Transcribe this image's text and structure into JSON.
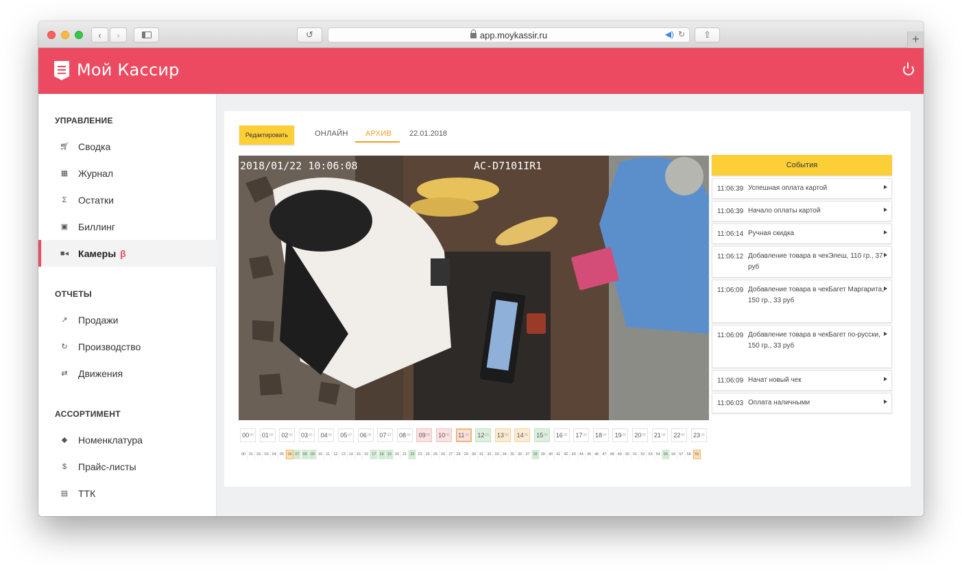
{
  "browser": {
    "url": "app.moykassir.ru"
  },
  "app": {
    "brand": "Мой Кассир"
  },
  "sidebar": {
    "sections": [
      {
        "title": "УПРАВЛЕНИЕ",
        "items": [
          {
            "label": "Сводка",
            "icon": "cart-icon"
          },
          {
            "label": "Журнал",
            "icon": "calendar-icon"
          },
          {
            "label": "Остатки",
            "icon": "sigma-icon"
          },
          {
            "label": "Биллинг",
            "icon": "wallet-icon"
          },
          {
            "label": "Камеры",
            "icon": "camera-icon",
            "active": true,
            "badge": "β"
          }
        ]
      },
      {
        "title": "ОТЧЕТЫ",
        "items": [
          {
            "label": "Продажи",
            "icon": "trending-up-icon"
          },
          {
            "label": "Производство",
            "icon": "refresh-icon"
          },
          {
            "label": "Движения",
            "icon": "swap-icon"
          }
        ]
      },
      {
        "title": "АССОРТИМЕНТ",
        "items": [
          {
            "label": "Номенклатура",
            "icon": "tag-icon"
          },
          {
            "label": "Прайс-листы",
            "icon": "dollar-icon"
          },
          {
            "label": "ТТК",
            "icon": "clipboard-icon"
          }
        ]
      }
    ]
  },
  "toolbar": {
    "edit_label": "Редактировать",
    "tab_online": "ОНЛАЙН",
    "tab_archive": "АРХИВ",
    "date": "22.01.2018"
  },
  "video": {
    "timestamp": "2018/01/22 10:06:08",
    "camera_id": "AC-D7101IR1"
  },
  "events": {
    "title": "События",
    "items": [
      {
        "time": "11:06:39",
        "text": "Успешная оплата картой"
      },
      {
        "time": "11:06:39",
        "text": "Начало оплаты картой"
      },
      {
        "time": "11:06:14",
        "text": "Ручная скидка"
      },
      {
        "time": "11:06:12",
        "text": "Добавление товара в чекЭлеш, 110 гр., 37 руб"
      },
      {
        "time": "11:06:09",
        "text": "Добавление товара в чекБагет Маргарита, 150 гр., 33 руб"
      },
      {
        "time": "11:06:09",
        "text": "Добавление товара в чекБагет по-русски, 150 гр., 33 руб"
      },
      {
        "time": "11:06:09",
        "text": "Начат новый чек"
      },
      {
        "time": "11:06:03",
        "text": "Оплата наличными"
      }
    ]
  },
  "timeline": {
    "hours": [
      {
        "h": "00",
        "m": "00",
        "state": "none"
      },
      {
        "h": "01",
        "m": "00",
        "state": "none"
      },
      {
        "h": "02",
        "m": "00",
        "state": "none"
      },
      {
        "h": "03",
        "m": "00",
        "state": "none"
      },
      {
        "h": "04",
        "m": "00",
        "state": "none"
      },
      {
        "h": "05",
        "m": "00",
        "state": "none"
      },
      {
        "h": "06",
        "m": "00",
        "state": "none"
      },
      {
        "h": "07",
        "m": "00",
        "state": "none"
      },
      {
        "h": "08",
        "m": "00",
        "state": "none"
      },
      {
        "h": "09",
        "m": "00",
        "state": "red"
      },
      {
        "h": "10",
        "m": "00",
        "state": "red"
      },
      {
        "h": "11",
        "m": "00",
        "state": "red-selected"
      },
      {
        "h": "12",
        "m": "00",
        "state": "green"
      },
      {
        "h": "13",
        "m": "00",
        "state": "orange"
      },
      {
        "h": "14",
        "m": "00",
        "state": "orange"
      },
      {
        "h": "15",
        "m": "00",
        "state": "green"
      },
      {
        "h": "16",
        "m": "00",
        "state": "none"
      },
      {
        "h": "17",
        "m": "00",
        "state": "none"
      },
      {
        "h": "18",
        "m": "00",
        "state": "none"
      },
      {
        "h": "19",
        "m": "00",
        "state": "none"
      },
      {
        "h": "20",
        "m": "00",
        "state": "none"
      },
      {
        "h": "21",
        "m": "00",
        "state": "none"
      },
      {
        "h": "22",
        "m": "00",
        "state": "none"
      },
      {
        "h": "23",
        "m": "00",
        "state": "none"
      }
    ],
    "minutes": [
      "00",
      "01",
      "02",
      "03",
      "04",
      "05",
      "06",
      "07",
      "08",
      "09",
      "10",
      "11",
      "12",
      "13",
      "14",
      "15",
      "16",
      "17",
      "18",
      "19",
      "20",
      "21",
      "22",
      "23",
      "24",
      "25",
      "26",
      "27",
      "28",
      "29",
      "30",
      "31",
      "32",
      "33",
      "34",
      "35",
      "36",
      "37",
      "38",
      "39",
      "40",
      "41",
      "42",
      "43",
      "44",
      "45",
      "46",
      "47",
      "48",
      "49",
      "50",
      "51",
      "52",
      "53",
      "54",
      "55",
      "56",
      "57",
      "58",
      "59"
    ],
    "minute_green": [
      "07",
      "08",
      "09",
      "17",
      "18",
      "19",
      "22",
      "38",
      "55"
    ],
    "minute_orange": [
      "06",
      "59"
    ]
  },
  "colors": {
    "brand": "#ec4a60",
    "accent": "#fccf36",
    "tab_active": "#f59b23"
  }
}
